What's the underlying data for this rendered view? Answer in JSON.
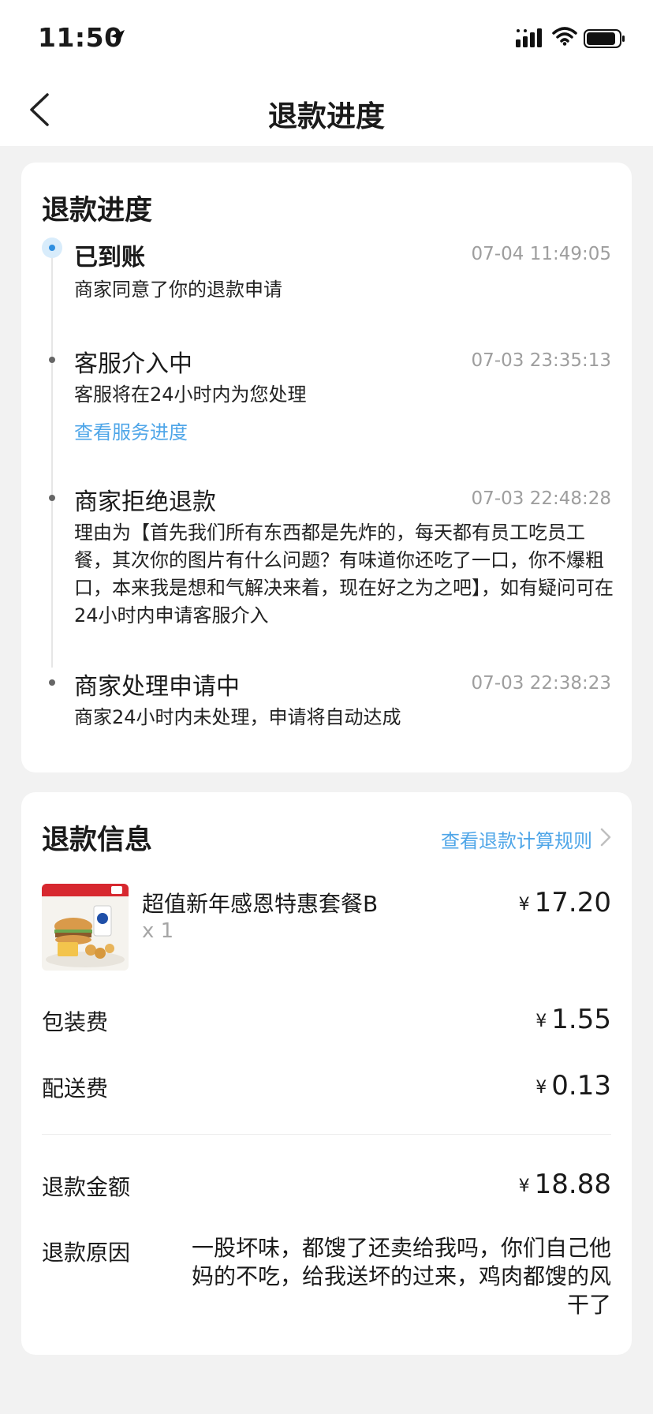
{
  "status_bar": {
    "time": "11:50"
  },
  "nav": {
    "title": "退款进度"
  },
  "progress": {
    "title": "退款进度",
    "steps": [
      {
        "title": "已到账",
        "time": "07-04 11:49:05",
        "desc": "商家同意了你的退款申请",
        "active": true
      },
      {
        "title": "客服介入中",
        "time": "07-03 23:35:13",
        "desc": "客服将在24小时内为您处理",
        "link": "查看服务进度"
      },
      {
        "title": "商家拒绝退款",
        "time": "07-03 22:48:28",
        "desc": "理由为【首先我们所有东西都是先炸的，每天都有员工吃员工餐，其次你的图片有什么问题？有味道你还吃了一口，你不爆粗口，本来我是想和气解决来着，现在好之为之吧】，如有疑问可在24小时内申请客服介入"
      },
      {
        "title": "商家处理申请中",
        "time": "07-03 22:38:23",
        "desc": "商家24小时内未处理，申请将自动达成"
      }
    ]
  },
  "refund_info": {
    "title": "退款信息",
    "rule_link": "查看退款计算规则",
    "item": {
      "name": "超值新年感恩特惠套餐B",
      "qty": "x 1",
      "price": "17.20"
    },
    "currency": "¥",
    "packaging": {
      "label": "包装费",
      "price": "1.55"
    },
    "delivery": {
      "label": "配送费",
      "price": "0.13"
    },
    "amount": {
      "label": "退款金额",
      "price": "18.88"
    },
    "reason": {
      "label": "退款原因",
      "text": "一股坏味，都馊了还卖给我吗，你们自己他妈的不吃，给我送坏的过来，鸡肉都馊的风干了"
    }
  }
}
